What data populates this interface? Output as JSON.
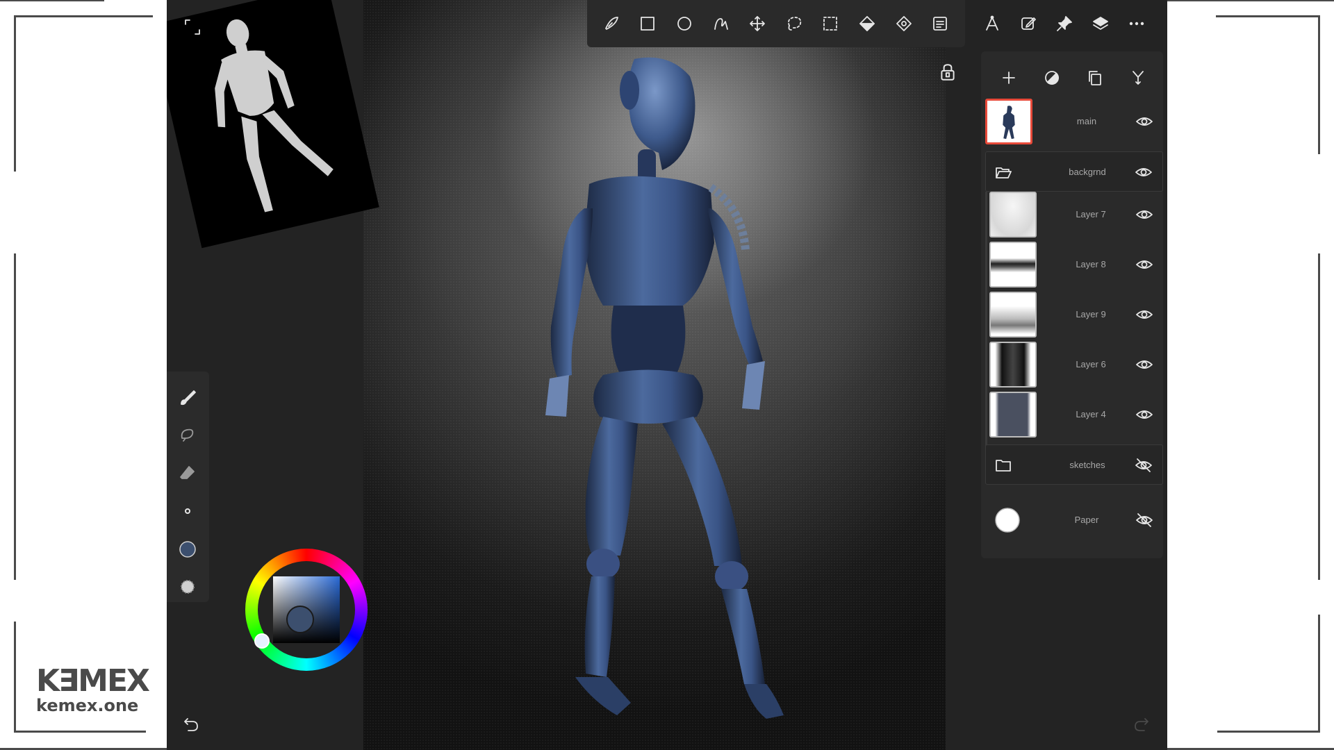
{
  "toolbar": {
    "tools": [
      "brush-library-icon",
      "rectangle-icon",
      "ellipse-icon",
      "pen-tool-icon",
      "move-icon",
      "lasso-icon",
      "marquee-icon",
      "fill-icon",
      "gradient-icon",
      "adjustments-icon"
    ],
    "right_tools": [
      "perspective-icon",
      "edit-icon",
      "pin-icon",
      "layers-icon",
      "more-icon"
    ]
  },
  "side_tools": [
    "brush-icon",
    "smudge-icon",
    "eraser-icon",
    "brush-size-icon",
    "color-swatch-icon",
    "opacity-icon"
  ],
  "colors": {
    "current": "#3c4f6e",
    "selected_layer_border": "#e84a3a"
  },
  "layers": {
    "actions": [
      "add-layer-icon",
      "mask-icon",
      "duplicate-icon",
      "merge-icon"
    ],
    "items": [
      {
        "name": "main",
        "kind": "layer",
        "visible": true,
        "selected": true
      },
      {
        "name": "backgrnd",
        "kind": "group",
        "visible": true
      },
      {
        "name": "Layer 7",
        "kind": "layer",
        "visible": true
      },
      {
        "name": "Layer 8",
        "kind": "layer",
        "visible": true
      },
      {
        "name": "Layer 9",
        "kind": "layer",
        "visible": true
      },
      {
        "name": "Layer 6",
        "kind": "layer",
        "visible": true
      },
      {
        "name": "Layer 4",
        "kind": "layer",
        "visible": true
      },
      {
        "name": "sketches",
        "kind": "group",
        "visible": false
      },
      {
        "name": "Paper",
        "kind": "paper",
        "visible": false
      }
    ]
  },
  "brand": {
    "logo": "K∃MEX",
    "url": "kemex.one"
  }
}
